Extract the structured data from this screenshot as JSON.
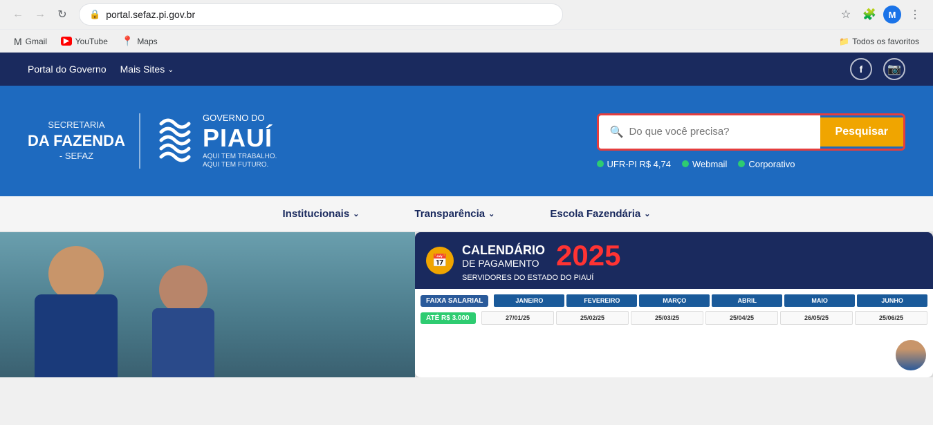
{
  "browser": {
    "url": "portal.sefaz.pi.gov.br",
    "nav": {
      "back_disabled": true,
      "forward_disabled": true
    },
    "bookmarks": [
      {
        "name": "Gmail",
        "icon": "gmail",
        "label": "Gmail"
      },
      {
        "name": "YouTube",
        "icon": "youtube",
        "label": "YouTube"
      },
      {
        "name": "Maps",
        "icon": "maps",
        "label": "Maps"
      }
    ],
    "favorites_label": "Todos os favoritos"
  },
  "top_nav": {
    "links": [
      {
        "label": "Portal do Governo"
      },
      {
        "label": "Mais Sites",
        "has_chevron": true
      }
    ],
    "social": {
      "facebook": "f",
      "instagram": "⬜"
    }
  },
  "hero": {
    "secretaria": {
      "da": "SECRETARIA",
      "fazenda": "DA FAZENDA",
      "sefaz": "- SEFAZ"
    },
    "governo": {
      "gov_do": "GOVERNO DO",
      "piaui": "PIAUÍ",
      "aqui1": "AQUI TEM TRABALHO.",
      "aqui2": "AQUI TEM FUTURO."
    },
    "search": {
      "placeholder": "Do que você precisa?",
      "button_label": "Pesquisar"
    },
    "quick_links": [
      {
        "label": "UFR-PI R$ 4,74"
      },
      {
        "label": "Webmail"
      },
      {
        "label": "Corporativo"
      }
    ]
  },
  "main_nav": {
    "items": [
      {
        "label": "Institucionais"
      },
      {
        "label": "Transparência"
      },
      {
        "label": "Escola Fazendária"
      }
    ]
  },
  "calendar": {
    "title": "CALENDÁRIO",
    "subtitle": "DE PAGAMENTO",
    "year": "2025",
    "description": "SERVIDORES DO ESTADO DO PIAUÍ",
    "salary_label": "FAIXA SALARIAL",
    "range_label": "ATÉ R$ 3.000",
    "months": [
      "JANEIRO",
      "FEVEREIRO",
      "MARÇO",
      "ABRIL",
      "MAIO",
      "JUNHO"
    ],
    "dates": [
      "27/01/25",
      "25/02/25",
      "25/03/25",
      "25/04/25",
      "26/05/25",
      "25/06/25"
    ]
  }
}
